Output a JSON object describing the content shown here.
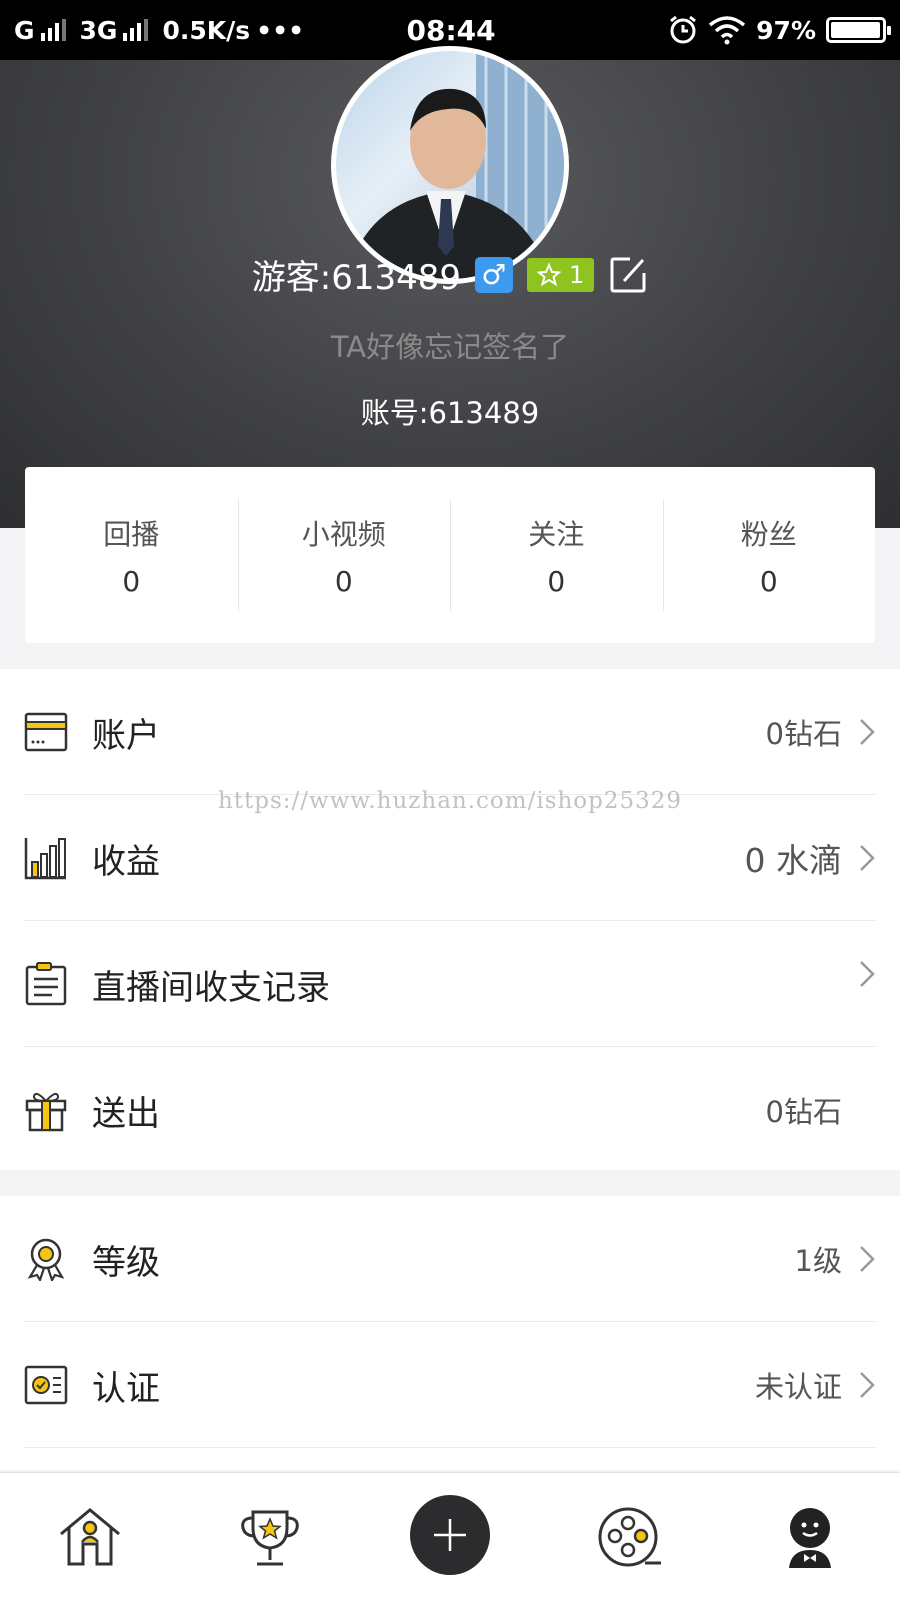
{
  "status_bar": {
    "network1": "G",
    "network2": "3G",
    "speed": "0.5K/s",
    "more": "•••",
    "time": "08:44",
    "battery": "97%",
    "battery_level": 0.97
  },
  "profile": {
    "name": "游客:613489",
    "gender_symbol": "♂",
    "level_value": "1",
    "signature": "TA好像忘记签名了",
    "account": "账号:613489"
  },
  "stats": [
    {
      "label": "回播",
      "value": "0"
    },
    {
      "label": "小视频",
      "value": "0"
    },
    {
      "label": "关注",
      "value": "0"
    },
    {
      "label": "粉丝",
      "value": "0"
    }
  ],
  "menu_group1": [
    {
      "icon": "wallet-icon",
      "label": "账户",
      "value": "0钻石",
      "chevron": true
    },
    {
      "icon": "bar-chart-icon",
      "label": "收益",
      "value": "0 水滴",
      "chevron": true
    },
    {
      "icon": "clipboard-icon",
      "label": "直播间收支记录",
      "value": "",
      "chevron": true
    },
    {
      "icon": "gift-icon",
      "label": "送出",
      "value": "0钻石",
      "chevron": false
    }
  ],
  "menu_group2": [
    {
      "icon": "medal-icon",
      "label": "等级",
      "value": "1级",
      "chevron": true
    },
    {
      "icon": "certificate-icon",
      "label": "认证",
      "value": "未认证",
      "chevron": true
    }
  ],
  "watermark": "https://www.huzhan.com/ishop25329",
  "bottom_nav": [
    "home-icon",
    "trophy-icon",
    "plus-icon",
    "film-reel-icon",
    "profile-icon"
  ],
  "colors": {
    "accent_yellow": "#f5c516",
    "gender_blue": "#3d9bef",
    "level_green": "#8fc31f",
    "header_dark": "#404144"
  }
}
